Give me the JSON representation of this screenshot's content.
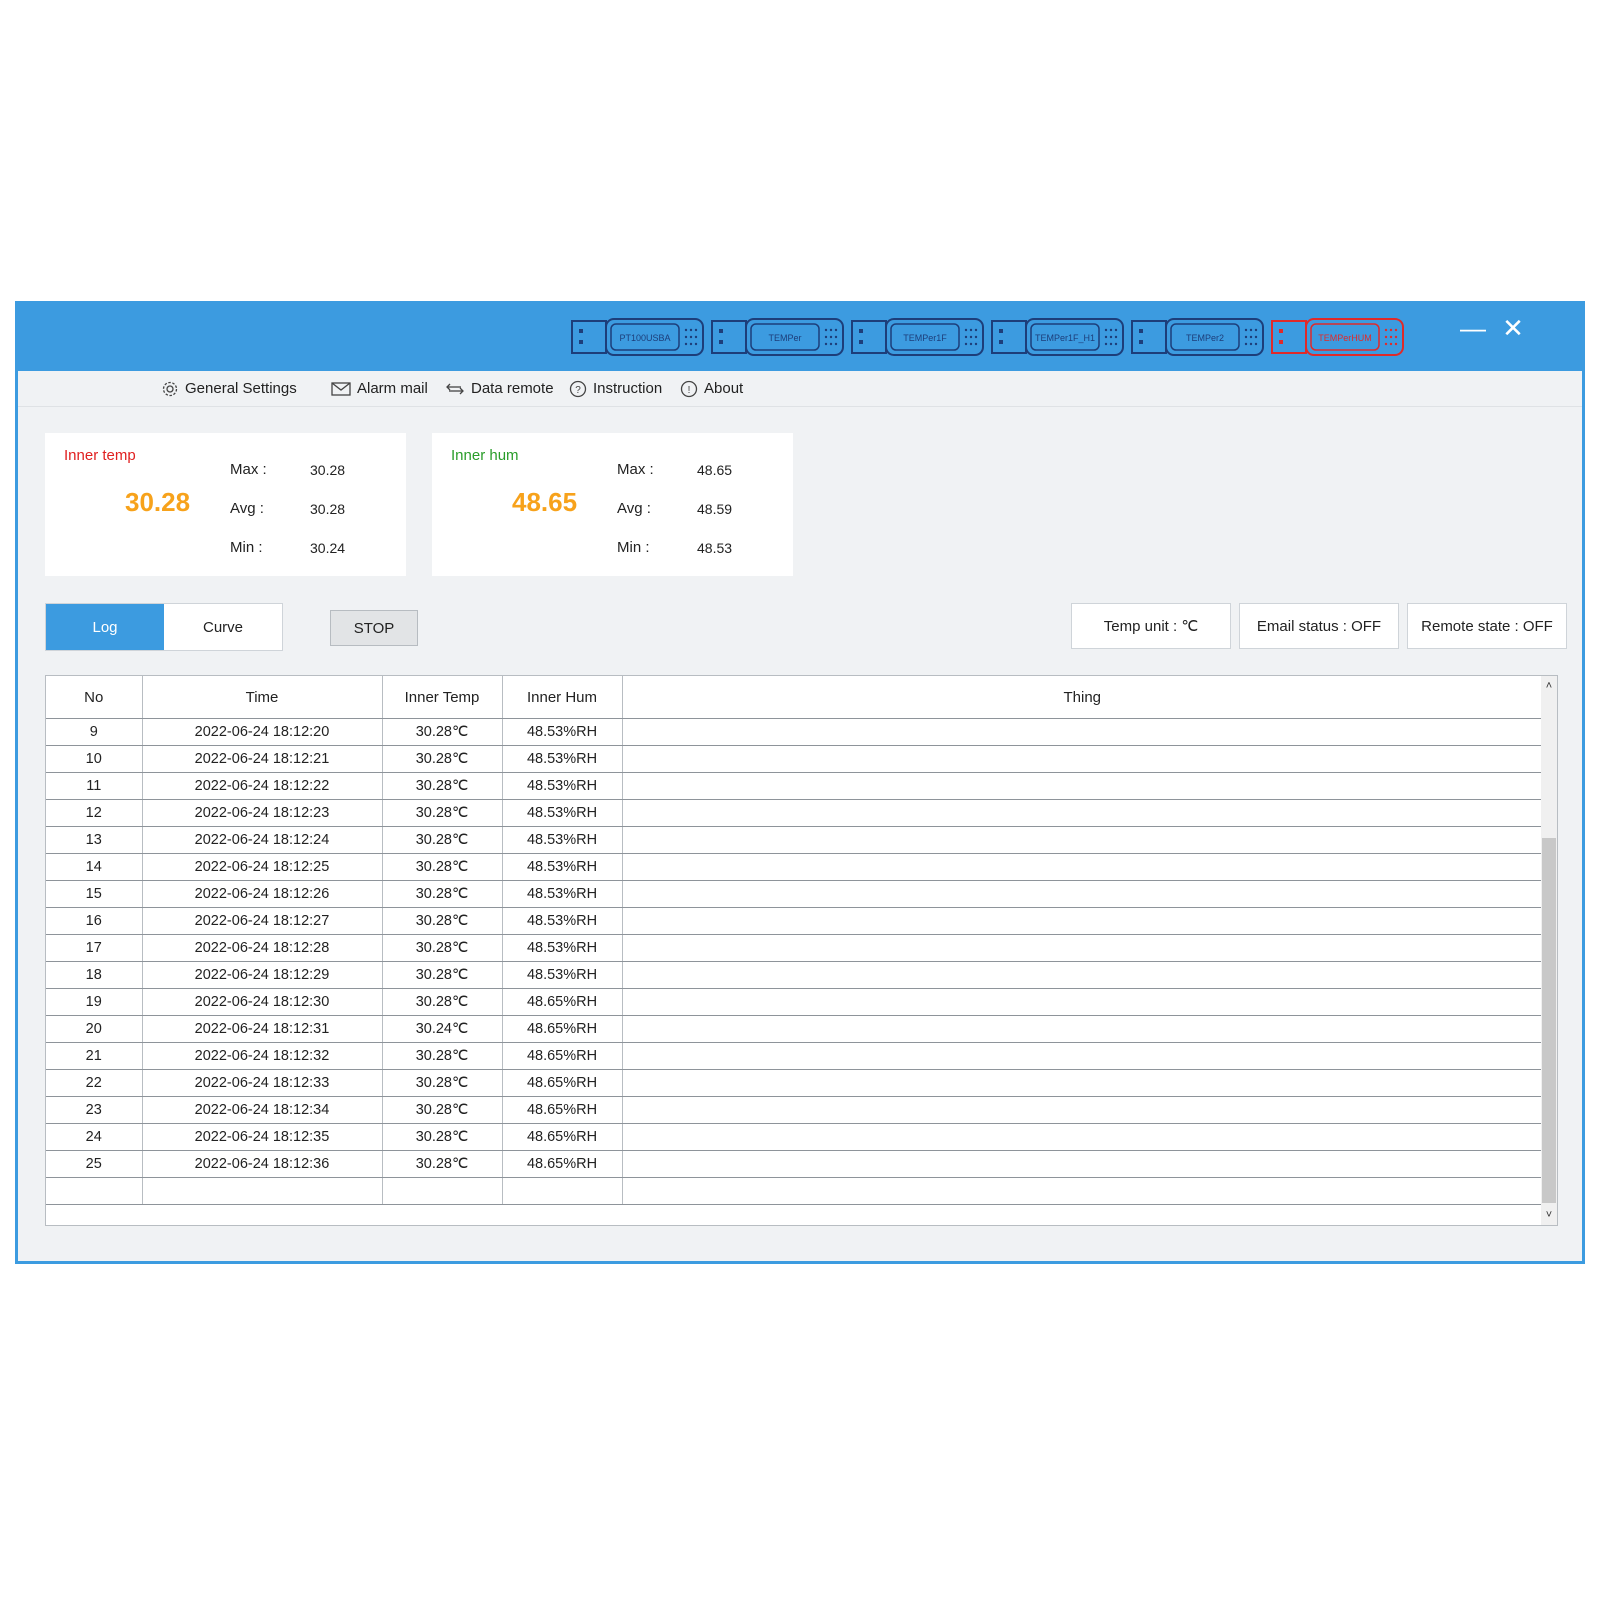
{
  "devices": [
    {
      "label": "PT100USBA",
      "alert": false
    },
    {
      "label": "TEMPer",
      "alert": false
    },
    {
      "label": "TEMPer1F",
      "alert": false
    },
    {
      "label": "TEMPer1F_H1",
      "alert": false
    },
    {
      "label": "TEMPer2",
      "alert": false
    },
    {
      "label": "TEMPerHUM",
      "alert": true
    }
  ],
  "menu": {
    "general_settings": "General Settings",
    "alarm_mail": "Alarm mail",
    "data_remote": "Data remote",
    "instruction": "Instruction",
    "about": "About"
  },
  "cards": {
    "temp": {
      "title": "Inner temp",
      "value": "30.28",
      "max_label": "Max :",
      "max": "30.28",
      "avg_label": "Avg :",
      "avg": "30.28",
      "min_label": "Min :",
      "min": "30.24"
    },
    "hum": {
      "title": "Inner hum",
      "value": "48.65",
      "max_label": "Max :",
      "max": "48.65",
      "avg_label": "Avg :",
      "avg": "48.59",
      "min_label": "Min :",
      "min": "48.53"
    }
  },
  "tabs": {
    "log": "Log",
    "curve": "Curve"
  },
  "stop_label": "STOP",
  "status": {
    "temp_unit": "Temp unit : ℃",
    "email": "Email status : OFF",
    "remote": "Remote state : OFF"
  },
  "table": {
    "headers": [
      "No",
      "Time",
      "Inner Temp",
      "Inner Hum",
      "Thing"
    ],
    "rows": [
      [
        "9",
        "2022-06-24 18:12:20",
        "30.28℃",
        "48.53%RH",
        ""
      ],
      [
        "10",
        "2022-06-24 18:12:21",
        "30.28℃",
        "48.53%RH",
        ""
      ],
      [
        "11",
        "2022-06-24 18:12:22",
        "30.28℃",
        "48.53%RH",
        ""
      ],
      [
        "12",
        "2022-06-24 18:12:23",
        "30.28℃",
        "48.53%RH",
        ""
      ],
      [
        "13",
        "2022-06-24 18:12:24",
        "30.28℃",
        "48.53%RH",
        ""
      ],
      [
        "14",
        "2022-06-24 18:12:25",
        "30.28℃",
        "48.53%RH",
        ""
      ],
      [
        "15",
        "2022-06-24 18:12:26",
        "30.28℃",
        "48.53%RH",
        ""
      ],
      [
        "16",
        "2022-06-24 18:12:27",
        "30.28℃",
        "48.53%RH",
        ""
      ],
      [
        "17",
        "2022-06-24 18:12:28",
        "30.28℃",
        "48.53%RH",
        ""
      ],
      [
        "18",
        "2022-06-24 18:12:29",
        "30.28℃",
        "48.53%RH",
        ""
      ],
      [
        "19",
        "2022-06-24 18:12:30",
        "30.28℃",
        "48.65%RH",
        ""
      ],
      [
        "20",
        "2022-06-24 18:12:31",
        "30.24℃",
        "48.65%RH",
        ""
      ],
      [
        "21",
        "2022-06-24 18:12:32",
        "30.28℃",
        "48.65%RH",
        ""
      ],
      [
        "22",
        "2022-06-24 18:12:33",
        "30.28℃",
        "48.65%RH",
        ""
      ],
      [
        "23",
        "2022-06-24 18:12:34",
        "30.28℃",
        "48.65%RH",
        ""
      ],
      [
        "24",
        "2022-06-24 18:12:35",
        "30.28℃",
        "48.65%RH",
        ""
      ],
      [
        "25",
        "2022-06-24 18:12:36",
        "30.28℃",
        "48.65%RH",
        ""
      ],
      [
        "",
        "",
        "",
        "",
        ""
      ]
    ]
  },
  "colors": {
    "accent": "#3c9be0",
    "value_orange": "#f7a21b",
    "temp_title": "#e02020",
    "hum_title": "#2a9d2a",
    "device_alert": "#e02a2a",
    "device_normal": "#1d3e7a"
  }
}
